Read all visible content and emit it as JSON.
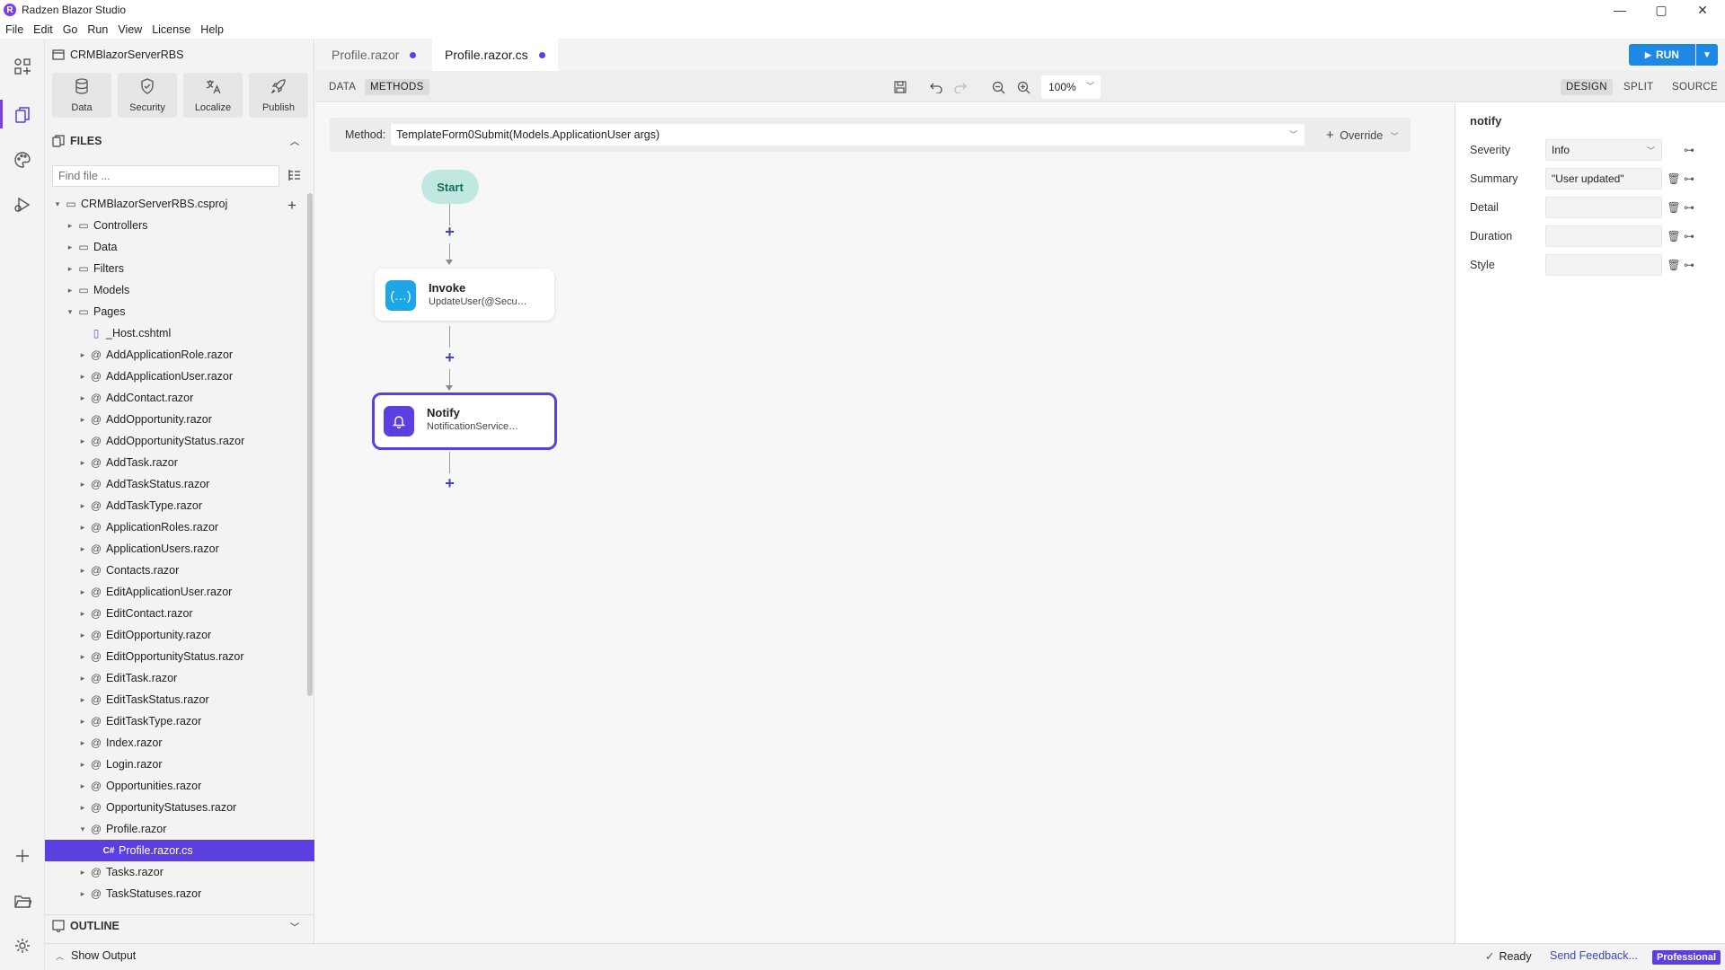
{
  "app": {
    "title": "Radzen Blazor Studio",
    "logo_letter": "R"
  },
  "window_controls": {
    "minimize": "—",
    "maximize": "▢",
    "close": "✕"
  },
  "menu": [
    "File",
    "Edit",
    "Go",
    "Run",
    "View",
    "License",
    "Help"
  ],
  "activity_bar": {
    "icons": [
      "components-icon",
      "files-icon",
      "palette-icon",
      "debug-icon",
      "add-icon",
      "folder-open-icon",
      "settings-icon"
    ],
    "active": "files-icon"
  },
  "sidebar": {
    "project_name": "CRMBlazorServerRBS",
    "tools": [
      {
        "label": "Data",
        "icon": "database-icon"
      },
      {
        "label": "Security",
        "icon": "shield-icon"
      },
      {
        "label": "Localize",
        "icon": "translate-icon"
      },
      {
        "label": "Publish",
        "icon": "rocket-icon"
      }
    ],
    "files_header": "FILES",
    "find_placeholder": "Find file ...",
    "outline_header": "OUTLINE",
    "tree": [
      {
        "label": "CRMBlazorServerRBS.csproj",
        "type": "project",
        "depth": 0,
        "expanded": true
      },
      {
        "label": "Controllers",
        "type": "folder",
        "depth": 1,
        "expanded": false
      },
      {
        "label": "Data",
        "type": "folder",
        "depth": 1,
        "expanded": false
      },
      {
        "label": "Filters",
        "type": "folder",
        "depth": 1,
        "expanded": false
      },
      {
        "label": "Models",
        "type": "folder",
        "depth": 1,
        "expanded": false
      },
      {
        "label": "Pages",
        "type": "folder",
        "depth": 1,
        "expanded": true
      },
      {
        "label": "_Host.cshtml",
        "type": "file",
        "depth": 2
      },
      {
        "label": "AddApplicationRole.razor",
        "type": "razor",
        "depth": 2
      },
      {
        "label": "AddApplicationUser.razor",
        "type": "razor",
        "depth": 2
      },
      {
        "label": "AddContact.razor",
        "type": "razor",
        "depth": 2
      },
      {
        "label": "AddOpportunity.razor",
        "type": "razor",
        "depth": 2
      },
      {
        "label": "AddOpportunityStatus.razor",
        "type": "razor",
        "depth": 2
      },
      {
        "label": "AddTask.razor",
        "type": "razor",
        "depth": 2
      },
      {
        "label": "AddTaskStatus.razor",
        "type": "razor",
        "depth": 2
      },
      {
        "label": "AddTaskType.razor",
        "type": "razor",
        "depth": 2
      },
      {
        "label": "ApplicationRoles.razor",
        "type": "razor",
        "depth": 2
      },
      {
        "label": "ApplicationUsers.razor",
        "type": "razor",
        "depth": 2
      },
      {
        "label": "Contacts.razor",
        "type": "razor",
        "depth": 2
      },
      {
        "label": "EditApplicationUser.razor",
        "type": "razor",
        "depth": 2
      },
      {
        "label": "EditContact.razor",
        "type": "razor",
        "depth": 2
      },
      {
        "label": "EditOpportunity.razor",
        "type": "razor",
        "depth": 2
      },
      {
        "label": "EditOpportunityStatus.razor",
        "type": "razor",
        "depth": 2
      },
      {
        "label": "EditTask.razor",
        "type": "razor",
        "depth": 2
      },
      {
        "label": "EditTaskStatus.razor",
        "type": "razor",
        "depth": 2
      },
      {
        "label": "EditTaskType.razor",
        "type": "razor",
        "depth": 2
      },
      {
        "label": "Index.razor",
        "type": "razor",
        "depth": 2
      },
      {
        "label": "Login.razor",
        "type": "razor",
        "depth": 2
      },
      {
        "label": "Opportunities.razor",
        "type": "razor",
        "depth": 2
      },
      {
        "label": "OpportunityStatuses.razor",
        "type": "razor",
        "depth": 2
      },
      {
        "label": "Profile.razor",
        "type": "razor",
        "depth": 2,
        "expanded": true
      },
      {
        "label": "Profile.razor.cs",
        "type": "cs",
        "depth": 3,
        "selected": true
      },
      {
        "label": "Tasks.razor",
        "type": "razor",
        "depth": 2
      },
      {
        "label": "TaskStatuses.razor",
        "type": "razor",
        "depth": 2
      }
    ]
  },
  "tabs": [
    {
      "label": "Profile.razor",
      "active": false,
      "modified": true
    },
    {
      "label": "Profile.razor.cs",
      "active": true,
      "modified": true
    }
  ],
  "run_button": {
    "label": "RUN"
  },
  "toolbar": {
    "mode_tabs": [
      {
        "label": "DATA",
        "active": false
      },
      {
        "label": "METHODS",
        "active": true
      }
    ],
    "zoom": "100%",
    "view_tabs": [
      {
        "label": "DESIGN",
        "active": true
      },
      {
        "label": "SPLIT",
        "active": false
      },
      {
        "label": "SOURCE",
        "active": false
      }
    ]
  },
  "method_bar": {
    "label": "Method:",
    "value": "TemplateForm0Submit(Models.ApplicationUser args)",
    "override": "Override"
  },
  "flow": {
    "start": "Start",
    "nodes": [
      {
        "title": "Invoke",
        "subtitle": "UpdateUser(@Security.User.Id, args)",
        "icon": "braces-icon",
        "color": "#1ea7e8",
        "selected": false
      },
      {
        "title": "Notify",
        "subtitle": "NotificationService.Notify",
        "icon": "bell-icon",
        "color": "#5b3fe0",
        "selected": true
      }
    ]
  },
  "properties": {
    "title": "notify",
    "rows": [
      {
        "label": "Severity",
        "value": "Info",
        "dropdown": true
      },
      {
        "label": "Summary",
        "value": "\"User updated\""
      },
      {
        "label": "Detail",
        "value": ""
      },
      {
        "label": "Duration",
        "value": ""
      },
      {
        "label": "Style",
        "value": ""
      }
    ]
  },
  "statusbar": {
    "show_output": "Show Output",
    "ready": "Ready",
    "feedback": "Send Feedback...",
    "license": "Professional"
  },
  "colors": {
    "accent": "#5b3fe0",
    "run": "#1e88e5",
    "start_node": "#bfe9e0"
  }
}
